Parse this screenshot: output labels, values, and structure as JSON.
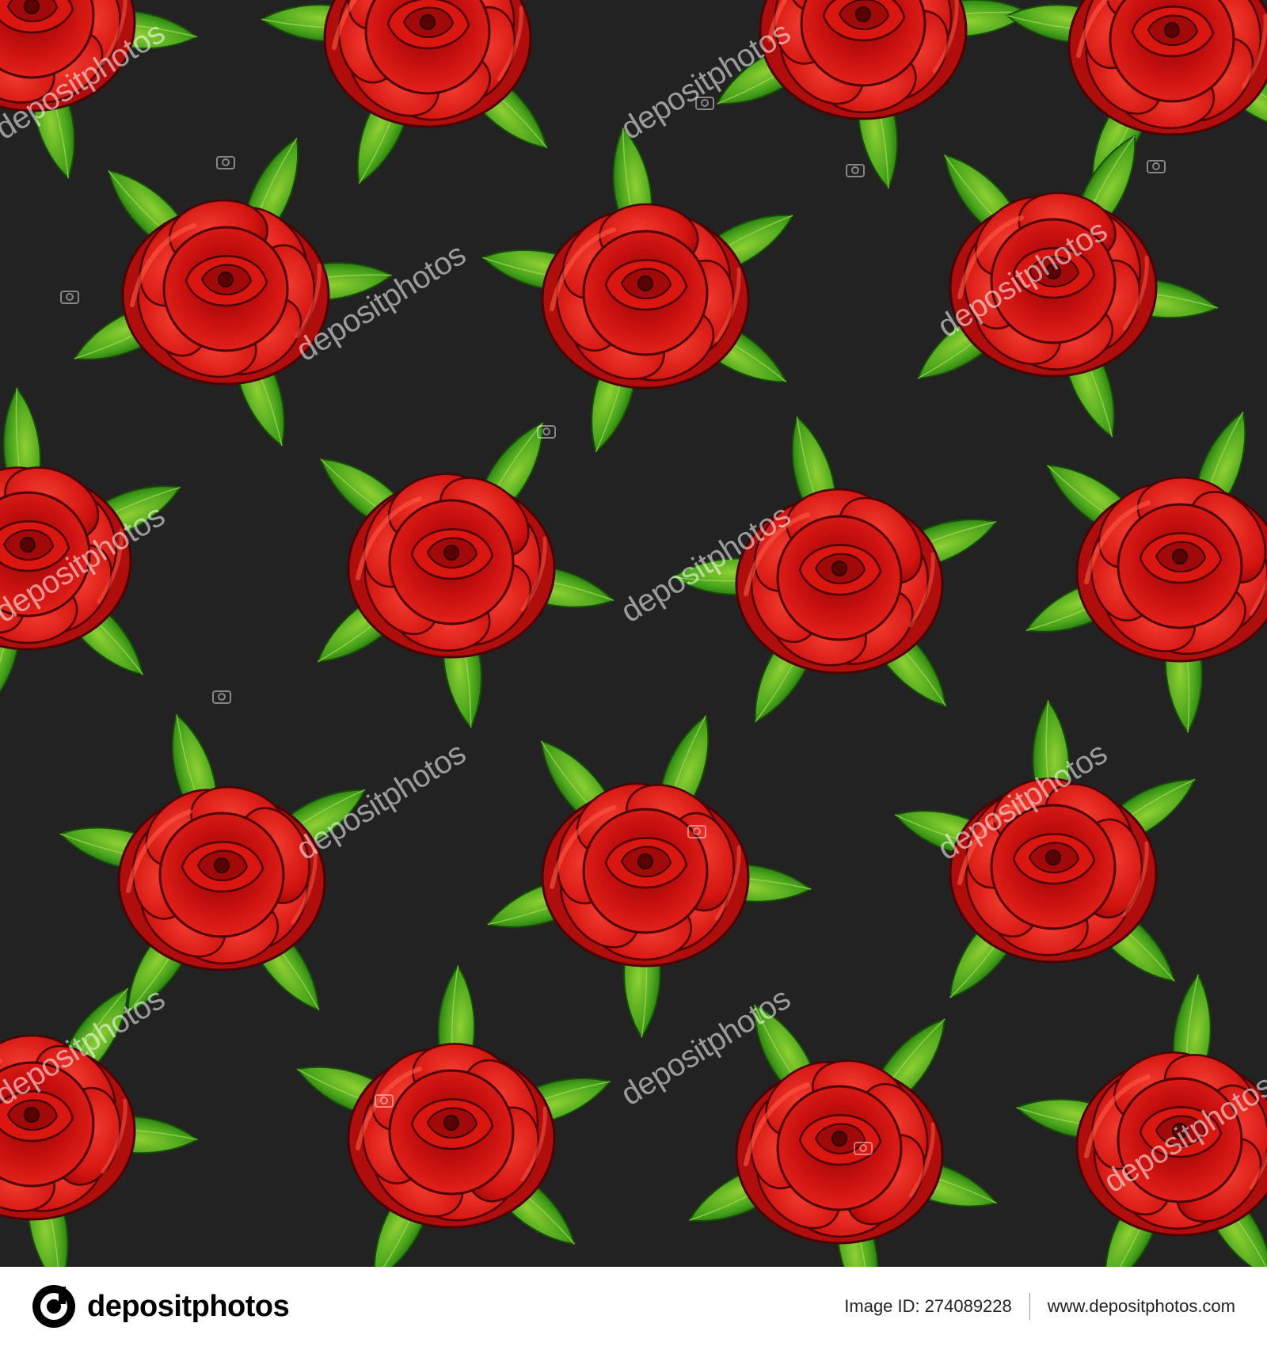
{
  "watermark": {
    "text": "depositphotos"
  },
  "footer": {
    "brand_name": "depositphotos",
    "image_id_label": "Image ID:",
    "image_id_value": "274089228",
    "site_url": "www.depositphotos.com"
  },
  "colors": {
    "background": "#222222",
    "rose_red": "#d81412",
    "rose_dark": "#7c0505",
    "leaf_green": "#3f9a17",
    "leaf_light": "#7cc62a"
  },
  "icons": [
    "camera-icon",
    "depositphotos-logo-icon"
  ]
}
